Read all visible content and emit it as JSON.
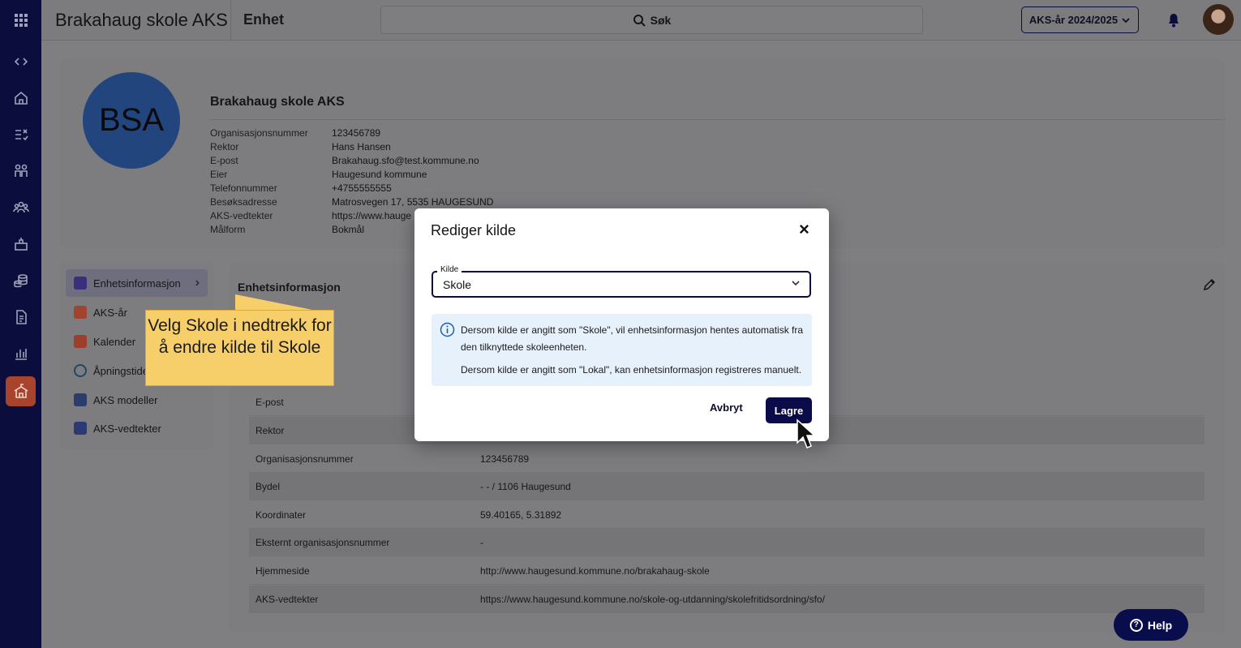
{
  "app": {
    "title": "Brakahaug skole AKS",
    "page_title": "Enhet"
  },
  "header": {
    "search_label": "Søk",
    "year_select": "AKS-år 2024/2025"
  },
  "rail": {
    "items": [
      "apps-grid-icon",
      "collapse-icon",
      "home-icon",
      "tasks-icon",
      "children-icon",
      "groups-icon",
      "unit-icon",
      "finance-icon",
      "document-icon",
      "reports-icon",
      "school-icon"
    ]
  },
  "profile": {
    "initials": "BSA",
    "name": "Brakahaug skole AKS",
    "rows": [
      {
        "key": "Organisasjonsnummer",
        "value": "123456789"
      },
      {
        "key": "Rektor",
        "value": "Hans Hansen"
      },
      {
        "key": "E-post",
        "value": "Brakahaug.sfo@test.kommune.no"
      },
      {
        "key": "Eier",
        "value": "Haugesund kommune"
      },
      {
        "key": "Telefonnummer",
        "value": "+4755555555"
      },
      {
        "key": "Besøksadresse",
        "value": "Matrosvegen 17, 5535 HAUGESUND"
      },
      {
        "key": "AKS-vedtekter",
        "value": "https://www.hauge"
      },
      {
        "key": "Målform",
        "value": "Bokmål"
      }
    ]
  },
  "menu": {
    "items": [
      {
        "label": "Enhetsinformasjon",
        "color": "#3a2f7a"
      },
      {
        "label": "AKS-år",
        "color": "#a0432f"
      },
      {
        "label": "Kalender",
        "color": "#9c3f2c"
      },
      {
        "label": "Åpningstider",
        "color": "#1a4a63"
      },
      {
        "label": "AKS modeller",
        "color": "#2a3d6b"
      },
      {
        "label": "AKS-vedtekter",
        "color": "#2b3a73"
      }
    ]
  },
  "details": {
    "title": "Enhetsinformasjon",
    "rows": [
      {
        "key": "E-post",
        "value": ""
      },
      {
        "key": "Rektor",
        "value": ""
      },
      {
        "key": "Organisasjonsnummer",
        "value": "123456789"
      },
      {
        "key": "Bydel",
        "value": "- - / 1106 Haugesund"
      },
      {
        "key": "Koordinater",
        "value": "59.40165, 5.31892"
      },
      {
        "key": "Eksternt organisasjonsnummer",
        "value": "-"
      },
      {
        "key": "Hjemmeside",
        "value": "http://www.haugesund.kommune.no/brakahaug-skole"
      },
      {
        "key": "AKS-vedtekter",
        "value": "https://www.haugesund.kommune.no/skole-og-utdanning/skolefritidsordning/sfo/"
      }
    ]
  },
  "callout": {
    "text": "Velg Skole i nedtrekk for å endre kilde til Skole"
  },
  "modal": {
    "title": "Rediger kilde",
    "field_label": "Kilde",
    "field_value": "Skole",
    "info_p1": "Dersom kilde er angitt som \"Skole\", vil enhetsinformasjon hentes automatisk fra den tilknyttede skoleenheten.",
    "info_p2": "Dersom kilde er angitt som \"Lokal\", kan enhetsinformasjon registreres manuelt.",
    "cancel_label": "Avbryt",
    "save_label": "Lagre"
  },
  "help": {
    "label": "Help"
  },
  "colors": {
    "primary": "#0a0b48",
    "accent": "#a8442b",
    "callout": "#f7cf6a",
    "info_bg": "#e6f1fb"
  }
}
